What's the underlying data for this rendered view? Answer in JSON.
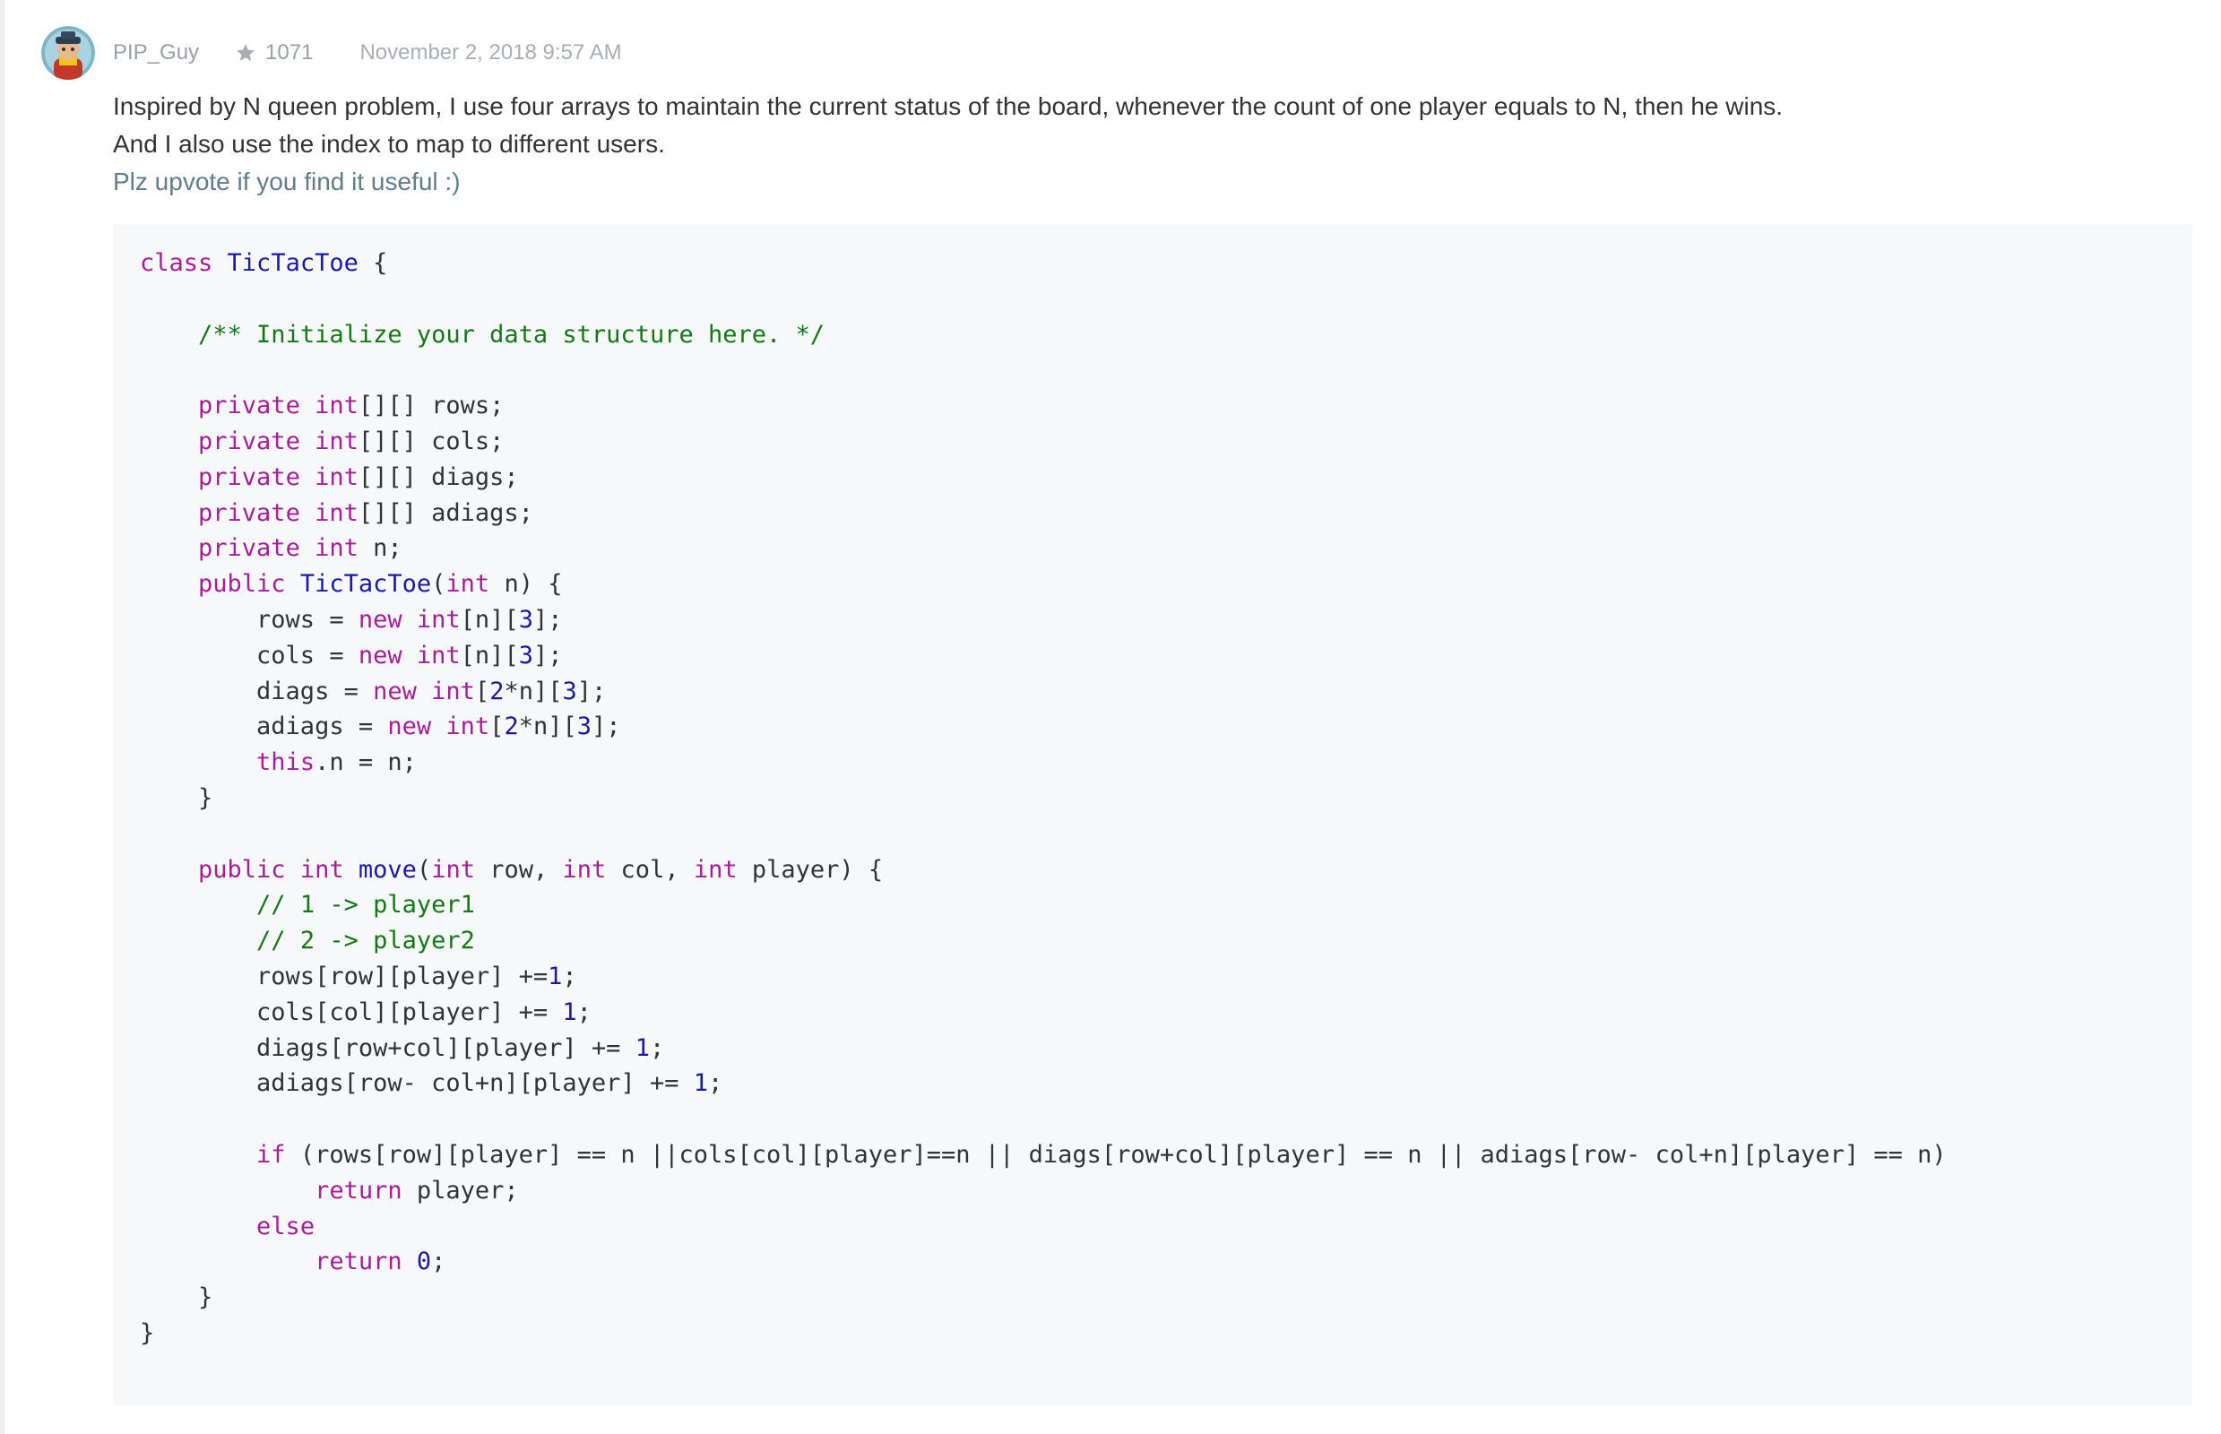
{
  "post": {
    "author": "PIP_Guy",
    "reputation": "1071",
    "date": "November 2, 2018 9:57 AM",
    "avatar_icon": "user-avatar",
    "star_icon": "star-icon",
    "paragraphs": [
      "Inspired by N queen problem, I use four arrays to maintain the current status of the board, whenever the count of one player equals to N, then he wins.",
      "And I also use the index to map to different users.",
      "Plz upvote if you find it useful :)"
    ]
  },
  "code": {
    "language": "java",
    "lines": [
      "class TicTacToe {",
      "",
      "    /** Initialize your data structure here. */",
      "",
      "    private int[][] rows;",
      "    private int[][] cols;",
      "    private int[][] diags;",
      "    private int[][] adiags;",
      "    private int n;",
      "    public TicTacToe(int n) {",
      "        rows = new int[n][3];",
      "        cols = new int[n][3];",
      "        diags = new int[2*n][3];",
      "        adiags = new int[2*n][3];",
      "        this.n = n;",
      "    }",
      "",
      "    public int move(int row, int col, int player) {",
      "        // 1 -> player1",
      "        // 2 -> player2",
      "        rows[row][player] +=1;",
      "        cols[col][player] += 1;",
      "        diags[row+col][player] += 1;",
      "        adiags[row- col+n][player] += 1;",
      "",
      "        if (rows[row][player] == n ||cols[col][player]==n || diags[row+col][player] == n || adiags[row- col+n][player] == n)",
      "            return player;",
      "        else",
      "            return 0;",
      "    }",
      "}"
    ]
  }
}
